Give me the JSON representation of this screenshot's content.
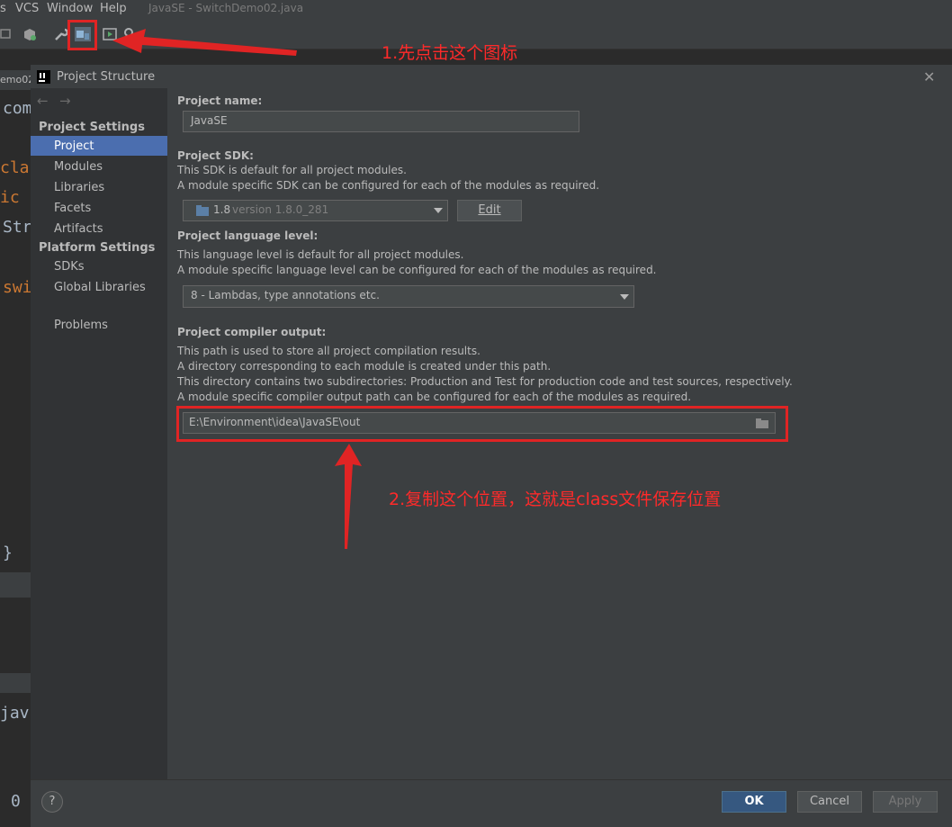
{
  "menu": {
    "item_s": "s",
    "vcs": "VCS",
    "window": "Window",
    "help": "Help"
  },
  "window_title": "JavaSE - SwitchDemo02.java",
  "editor": {
    "tab": "emo02",
    "lines": [
      "com",
      "clas",
      "ic",
      "Str",
      "swi",
      "}",
      "jav",
      "0"
    ]
  },
  "dialog": {
    "title": "Project Structure",
    "close": "✕"
  },
  "sidebar": {
    "nav_back": "←",
    "nav_forward": "→",
    "project_settings": "Project Settings",
    "items_project": [
      "Project",
      "Modules",
      "Libraries",
      "Facets",
      "Artifacts"
    ],
    "platform_settings": "Platform Settings",
    "items_platform": [
      "SDKs",
      "Global Libraries"
    ],
    "problems": "Problems"
  },
  "main": {
    "project_name_label": "Project name:",
    "project_name_value": "JavaSE",
    "sdk_label": "Project SDK:",
    "sdk_desc1": "This SDK is default for all project modules.",
    "sdk_desc2": "A module specific SDK can be configured for each of the modules as required.",
    "sdk_value": "1.8",
    "sdk_version": "version 1.8.0_281",
    "edit_button": "Edit",
    "lang_label": "Project language level:",
    "lang_desc1": "This language level is default for all project modules.",
    "lang_desc2": "A module specific language level can be configured for each of the modules as required.",
    "lang_value": "8 - Lambdas, type annotations etc.",
    "output_label": "Project compiler output:",
    "output_desc1": "This path is used to store all project compilation results.",
    "output_desc2": "A directory corresponding to each module is created under this path.",
    "output_desc3": "This directory contains two subdirectories: Production and Test for production code and test sources, respectively.",
    "output_desc4": "A module specific compiler output path can be configured for each of the modules as required.",
    "output_value": "E:\\Environment\\idea\\JavaSE\\out"
  },
  "footer": {
    "help": "?",
    "ok": "OK",
    "cancel": "Cancel",
    "apply": "Apply"
  },
  "annotations": {
    "step1": "1.先点击这个图标",
    "step2": "2.复制这个位置，这就是class文件保存位置"
  },
  "colors": {
    "accent": "#4b6eaf",
    "annotation": "#e02424"
  }
}
